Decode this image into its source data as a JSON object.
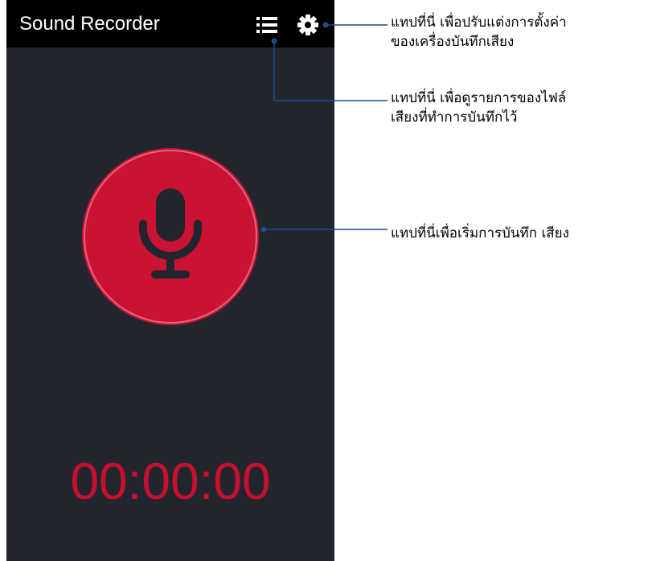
{
  "app": {
    "title": "Sound Recorder",
    "timer": "00:00:00"
  },
  "toolbar": {
    "list_icon": "list-icon",
    "settings_icon": "gear-icon"
  },
  "record": {
    "icon": "microphone-icon"
  },
  "annotations": {
    "settings": {
      "line1": "แทปที่นี่ เพื่อปรับแต่งการตั้งค่า",
      "line2": "ของเครื่องบันทึกเสียง"
    },
    "list": {
      "line1": "แทปที่นี่ เพื่อดูรายการของไฟล์",
      "line2": "เสียงที่ทำการบันทึกไว้"
    },
    "record": {
      "line1": "แทปที่นี่เพื่อเริ่มการบันทึก เสียง"
    }
  },
  "colors": {
    "app_background": "#22252e",
    "app_bar": "#000000",
    "record_button": "#cb1234",
    "mic_icon": "#22252e",
    "timer_text": "#c8102e",
    "callout_line": "#1a4d8c"
  }
}
